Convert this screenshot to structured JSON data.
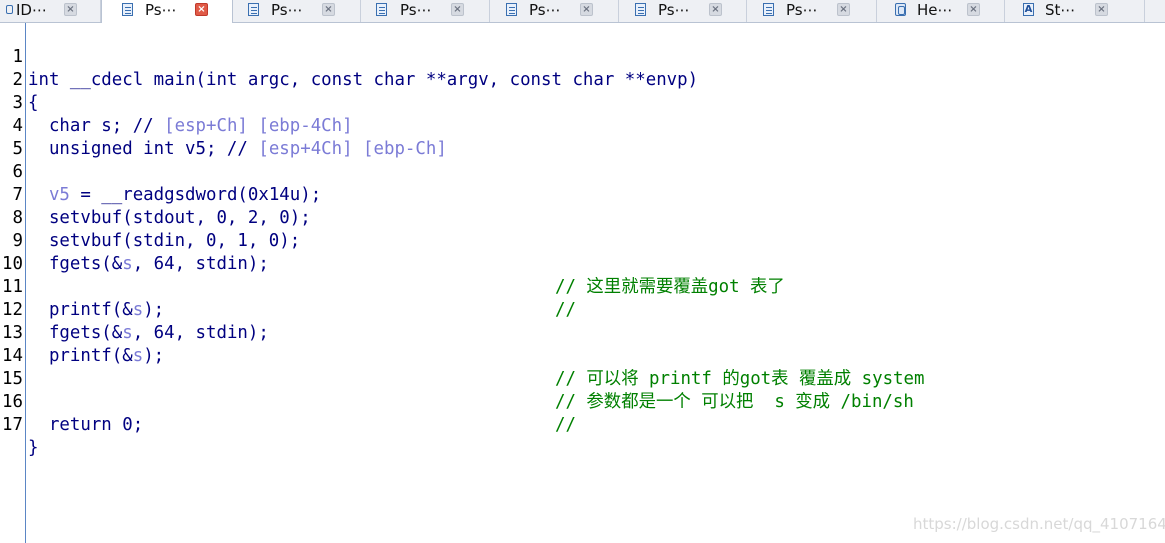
{
  "tabs": [
    {
      "label": "ID⋯",
      "icon": "ida-view-icon",
      "active": false
    },
    {
      "label": "Ps⋯",
      "icon": "pseudocode-icon",
      "active": true
    },
    {
      "label": "Ps⋯",
      "icon": "pseudocode-icon",
      "active": false
    },
    {
      "label": "Ps⋯",
      "icon": "pseudocode-icon",
      "active": false
    },
    {
      "label": "Ps⋯",
      "icon": "pseudocode-icon",
      "active": false
    },
    {
      "label": "Ps⋯",
      "icon": "pseudocode-icon",
      "active": false
    },
    {
      "label": "Ps⋯",
      "icon": "pseudocode-icon",
      "active": false
    },
    {
      "label": "He⋯",
      "icon": "hex-view-icon",
      "active": false
    },
    {
      "label": "St⋯",
      "icon": "strings-icon",
      "active": false
    }
  ],
  "close_glyph": "×",
  "code": {
    "lines": [
      {
        "n": "1",
        "src": "int __cdecl main(int argc, const char **argv, const char **envp)",
        "comment": ""
      },
      {
        "n": "2",
        "src": "{",
        "comment": ""
      },
      {
        "n": "3",
        "src_a": "  char s; // ",
        "src_var": "[esp+Ch] [ebp-4Ch]",
        "comment": ""
      },
      {
        "n": "4",
        "src_a": "  unsigned int v5; // ",
        "src_var": "[esp+4Ch] [ebp-Ch]",
        "comment": ""
      },
      {
        "n": "5",
        "src": "",
        "comment": ""
      },
      {
        "n": "6",
        "src_v": "  v5",
        "src_b": " = __readgsdword(0x14u);",
        "comment": ""
      },
      {
        "n": "7",
        "src": "  setvbuf(stdout, 0, 2, 0);",
        "comment": ""
      },
      {
        "n": "8",
        "src": "  setvbuf(stdin, 0, 1, 0);",
        "comment": ""
      },
      {
        "n": "9",
        "src_pre": "  fgets(&",
        "src_var": "s",
        "src_post": ", 64, stdin);",
        "comment": "// 这里就需要覆盖got 表了"
      },
      {
        "n": "10",
        "src": "",
        "comment": "//"
      },
      {
        "n": "11",
        "src_pre": "  printf(&",
        "src_var": "s",
        "src_post": ");",
        "comment": ""
      },
      {
        "n": "12",
        "src_pre": "  fgets(&",
        "src_var": "s",
        "src_post": ", 64, stdin);",
        "comment": ""
      },
      {
        "n": "13",
        "src_pre": "  printf(&",
        "src_var": "s",
        "src_post": ");",
        "comment": "// 可以将 printf 的got表 覆盖成 system"
      },
      {
        "n": "14",
        "src": "",
        "comment": "// 参数都是一个 可以把  s 变成 /bin/sh"
      },
      {
        "n": "15",
        "src": "",
        "comment": "//"
      },
      {
        "n": "16",
        "src": "  return 0;",
        "comment": ""
      },
      {
        "n": "17",
        "src": "}",
        "comment": ""
      }
    ]
  },
  "watermark": "https://blog.csdn.net/qq_41071646",
  "colors": {
    "code": "#000080",
    "comment": "#008000",
    "variable": "#7b7bd6",
    "active_close": "#e05a47"
  }
}
